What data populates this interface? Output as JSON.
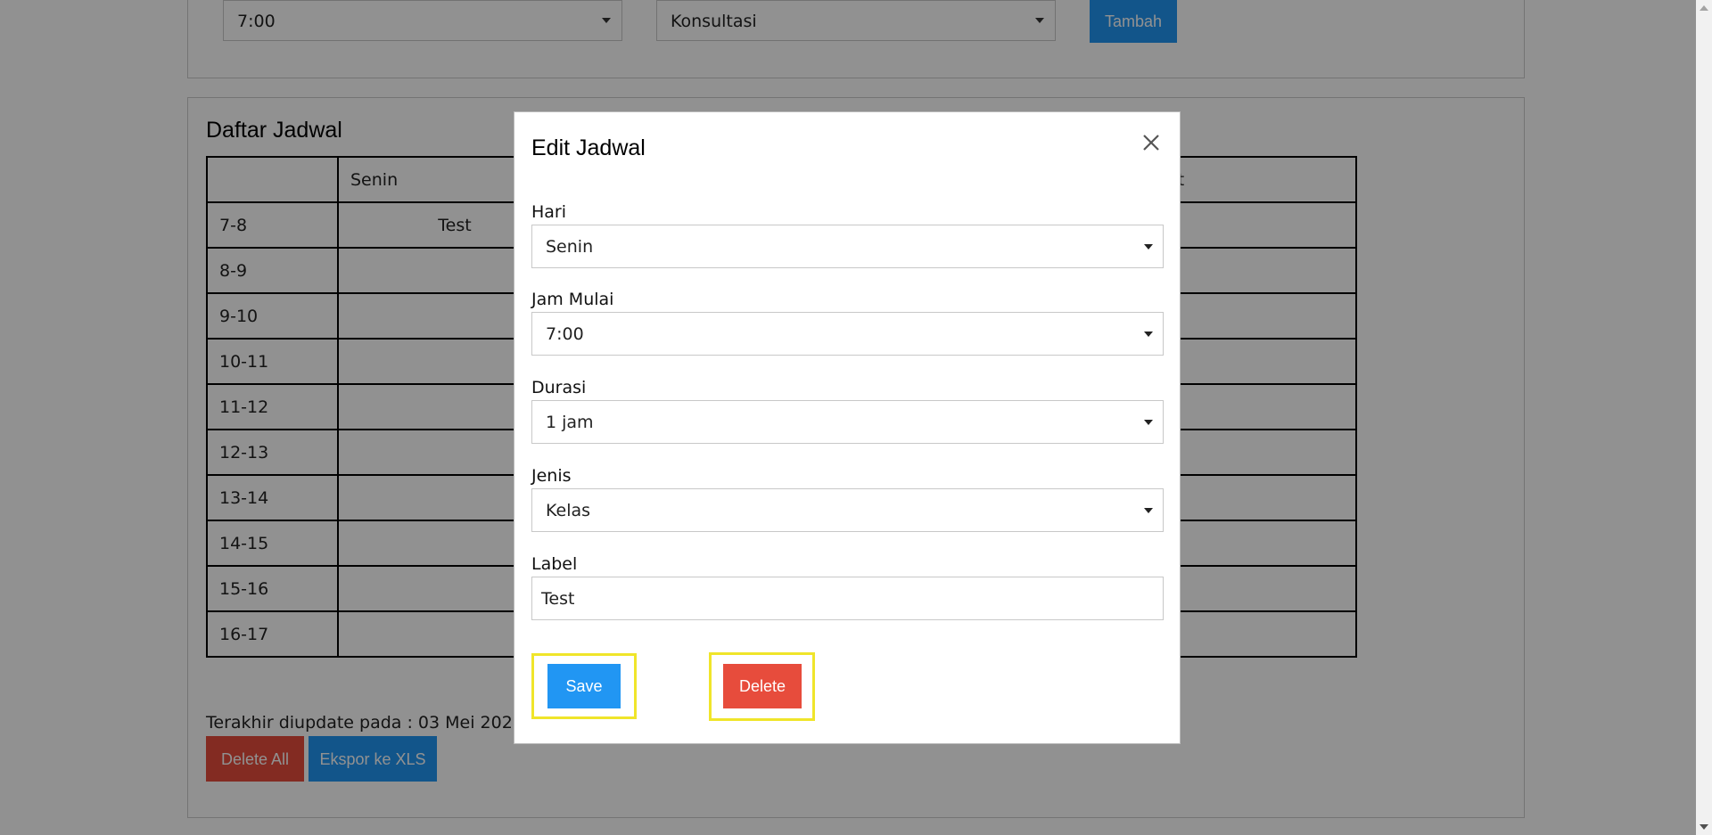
{
  "add_form": {
    "time_select": "7:00",
    "type_select": "Konsultasi",
    "add_button": "Tambah"
  },
  "schedule": {
    "title": "Daftar Jadwal",
    "days": [
      "",
      "Senin",
      "",
      "",
      "Jumat"
    ],
    "rows": [
      {
        "time": "7-8",
        "senin": "Test"
      },
      {
        "time": "8-9",
        "senin": ""
      },
      {
        "time": "9-10",
        "senin": ""
      },
      {
        "time": "10-11",
        "senin": ""
      },
      {
        "time": "11-12",
        "senin": ""
      },
      {
        "time": "12-13",
        "senin": ""
      },
      {
        "time": "13-14",
        "senin": ""
      },
      {
        "time": "14-15",
        "senin": ""
      },
      {
        "time": "15-16",
        "senin": ""
      },
      {
        "time": "16-17",
        "senin": ""
      }
    ],
    "updated_text": "Terakhir diupdate pada : 03 Mei 2020",
    "delete_all_button": "Delete All",
    "export_button": "Ekspor ke XLS"
  },
  "modal": {
    "title": "Edit Jadwal",
    "close_icon": "close-icon",
    "hari_label": "Hari",
    "hari_value": "Senin",
    "jam_label": "Jam Mulai",
    "jam_value": "7:00",
    "durasi_label": "Durasi",
    "durasi_value": "1 jam",
    "jenis_label": "Jenis",
    "jenis_value": "Kelas",
    "label_label": "Label",
    "label_value": "Test",
    "save_button": "Save",
    "delete_button": "Delete"
  },
  "colors": {
    "primary": "#2196f3",
    "danger": "#e74c3c",
    "highlight": "#f0e52a",
    "overlay": "rgba(0,0,0,0.43)"
  }
}
